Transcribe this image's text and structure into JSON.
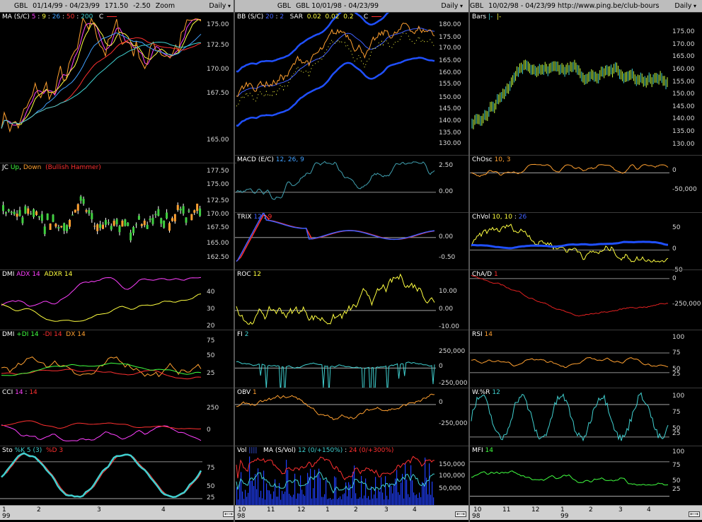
{
  "columns": [
    {
      "header": {
        "symbol": "GBL",
        "range": "01/14/99 - 04/23/99",
        "last": "171.50",
        "change": "-2.50",
        "zoom": "Zoom",
        "period": "Daily"
      },
      "xaxis": {
        "months": [
          "1",
          "2",
          "3",
          "4"
        ],
        "year": "99"
      },
      "panels": [
        {
          "title": [
            {
              "t": "MA (S/C) ",
              "c": "#ffffff"
            },
            {
              "t": "5",
              "c": "#ff40ff"
            },
            {
              "t": " : ",
              "c": "#ffffff"
            },
            {
              "t": "9",
              "c": "#ffff40"
            },
            {
              "t": " : ",
              "c": "#ffffff"
            },
            {
              "t": "26",
              "c": "#40a0ff"
            },
            {
              "t": " : ",
              "c": "#ffffff"
            },
            {
              "t": "50",
              "c": "#ff3030"
            },
            {
              "t": " : ",
              "c": "#ffffff"
            },
            {
              "t": "200",
              "c": "#40d0d0"
            },
            {
              "t": "   C ",
              "c": "#ffffff"
            }
          ],
          "scale": [
            "175.00",
            "172.50",
            "170.00",
            "167.50",
            "165.00"
          ]
        },
        {
          "title": [
            {
              "t": "JC ",
              "c": "#ffffff"
            },
            {
              "t": "Up",
              "c": "#40ff40"
            },
            {
              "t": ", ",
              "c": "#ffffff"
            },
            {
              "t": "Down",
              "c": "#ffa030"
            },
            {
              "t": "  (Bullish Hammer)",
              "c": "#ff3030"
            }
          ],
          "scale": [
            "177.50",
            "175.00",
            "172.50",
            "170.00",
            "167.50",
            "165.00",
            "162.50"
          ]
        },
        {
          "title": [
            {
              "t": "DMI ",
              "c": "#ffffff"
            },
            {
              "t": "ADX 14",
              "c": "#ff40ff"
            },
            {
              "t": "  ",
              "c": "#ffffff"
            },
            {
              "t": "ADXR 14",
              "c": "#ffff40"
            }
          ],
          "scale": [
            "40",
            "30",
            "20"
          ]
        },
        {
          "title": [
            {
              "t": "DMI ",
              "c": "#ffffff"
            },
            {
              "t": "+DI 14",
              "c": "#40ff40"
            },
            {
              "t": "  ",
              "c": "#ffffff"
            },
            {
              "t": "-DI 14",
              "c": "#ff3030"
            },
            {
              "t": "  ",
              "c": "#ffffff"
            },
            {
              "t": "DX 14",
              "c": "#ffa030"
            }
          ],
          "scale": [
            "75",
            "50",
            "25"
          ]
        },
        {
          "title": [
            {
              "t": "CCI ",
              "c": "#ffffff"
            },
            {
              "t": "14",
              "c": "#ff40ff"
            },
            {
              "t": " : ",
              "c": "#ffffff"
            },
            {
              "t": "14",
              "c": "#ff3030"
            }
          ],
          "scale": [
            "250",
            "0"
          ]
        },
        {
          "title": [
            {
              "t": "Sto ",
              "c": "#ffffff"
            },
            {
              "t": "%K 5 (3)",
              "c": "#40d0d0"
            },
            {
              "t": "  ",
              "c": "#ffffff"
            },
            {
              "t": "%D 3",
              "c": "#ff3030"
            }
          ],
          "scale": [
            "75",
            "50",
            "25"
          ]
        }
      ]
    },
    {
      "header": {
        "symbol": "GBL",
        "range": "GBL  10/01/98 - 04/23/99",
        "period": "Daily"
      },
      "xaxis": {
        "months": [
          "10",
          "11",
          "12",
          "1",
          "2",
          "3",
          "4"
        ],
        "year": "98"
      },
      "panels": [
        {
          "title": [
            {
              "t": "BB (S/C) ",
              "c": "#ffffff"
            },
            {
              "t": "20",
              "c": "#4060ff"
            },
            {
              "t": " : ",
              "c": "#ffffff"
            },
            {
              "t": "2",
              "c": "#4060ff"
            },
            {
              "t": "   SAR  ",
              "c": "#ffffff"
            },
            {
              "t": "0.02",
              "c": "#ffff40"
            },
            {
              "t": "  ",
              "c": "#ffffff"
            },
            {
              "t": "0.02",
              "c": "#ffff40"
            },
            {
              "t": "  ",
              "c": "#ffffff"
            },
            {
              "t": "0.2",
              "c": "#ffff40"
            },
            {
              "t": "     C ",
              "c": "#ffffff"
            }
          ],
          "scale": [
            "180.00",
            "175.00",
            "170.00",
            "165.00",
            "160.00",
            "155.00",
            "150.00",
            "145.00",
            "140.00",
            "135.00",
            "130.00"
          ]
        },
        {
          "title": [
            {
              "t": "MACD (E/C) ",
              "c": "#ffffff"
            },
            {
              "t": "12, 26, 9",
              "c": "#40a0ff"
            }
          ],
          "scale": [
            "2.50",
            "0.00"
          ]
        },
        {
          "title": [
            {
              "t": "TRIX ",
              "c": "#ffffff"
            },
            {
              "t": "12",
              "c": "#4060ff"
            },
            {
              "t": " : ",
              "c": "#ffffff"
            },
            {
              "t": "9",
              "c": "#ff3030"
            }
          ],
          "scale": [
            "0.00",
            "-0.50"
          ]
        },
        {
          "title": [
            {
              "t": "ROC ",
              "c": "#ffffff"
            },
            {
              "t": "12",
              "c": "#ffff40"
            }
          ],
          "scale": [
            "10.00",
            "0.00",
            "-10.00"
          ]
        },
        {
          "title": [
            {
              "t": "FI ",
              "c": "#ffffff"
            },
            {
              "t": "2",
              "c": "#40d0d0"
            }
          ],
          "scale": [
            "250,000",
            "0",
            "-250,000"
          ]
        },
        {
          "title": [
            {
              "t": "OBV ",
              "c": "#ffffff"
            },
            {
              "t": "1",
              "c": "#ffa030"
            }
          ],
          "scale": [
            "0",
            "-250,000"
          ]
        },
        {
          "title": [
            {
              "t": "Vol ",
              "c": "#ffffff"
            },
            {
              "t": "||||",
              "c": "#4060ff"
            },
            {
              "t": "   MA (S/Vol) ",
              "c": "#ffffff"
            },
            {
              "t": "12 (0/+150%)",
              "c": "#40d0d0"
            },
            {
              "t": " : ",
              "c": "#ffffff"
            },
            {
              "t": "24 (0/+300%)",
              "c": "#ff3030"
            }
          ],
          "scale": [
            "150,000",
            "100,000",
            "50,000"
          ]
        }
      ]
    },
    {
      "header": {
        "symbol": "GBL",
        "range": "10/02/98 - 04/23/99   http://www.ping.be/club-bourse",
        "period": "Daily"
      },
      "xaxis": {
        "months": [
          "10",
          "11",
          "12",
          "1",
          "2",
          "3",
          "4"
        ],
        "year": "98",
        "year2": "99"
      },
      "panels": [
        {
          "title": [
            {
              "t": "Bars ",
              "c": "#ffffff"
            },
            {
              "t": "|-",
              "c": "#40d0d0"
            },
            {
              "t": "  ",
              "c": "#ffffff"
            },
            {
              "t": "|-",
              "c": "#ffff40"
            }
          ],
          "scale": [
            "175.00",
            "170.00",
            "165.00",
            "160.00",
            "155.00",
            "150.00",
            "145.00",
            "140.00",
            "135.00",
            "130.00"
          ]
        },
        {
          "title": [
            {
              "t": "ChOsc ",
              "c": "#ffffff"
            },
            {
              "t": "10, 3",
              "c": "#ffa030"
            }
          ],
          "scale": [
            "0",
            "-50,000"
          ]
        },
        {
          "title": [
            {
              "t": "ChVol ",
              "c": "#ffffff"
            },
            {
              "t": "10, 10",
              "c": "#ffff40"
            },
            {
              "t": " : ",
              "c": "#ffffff"
            },
            {
              "t": "26",
              "c": "#4060ff"
            }
          ],
          "scale": [
            "50",
            "0",
            "-50"
          ]
        },
        {
          "title": [
            {
              "t": "ChA/D ",
              "c": "#ffffff"
            },
            {
              "t": "1",
              "c": "#ff3030"
            }
          ],
          "scale": [
            "0",
            "-250,000"
          ]
        },
        {
          "title": [
            {
              "t": "RSI ",
              "c": "#ffffff"
            },
            {
              "t": "14",
              "c": "#ffa030"
            }
          ],
          "scale": [
            "100",
            "75",
            "50",
            "25"
          ]
        },
        {
          "title": [
            {
              "t": "W.%R ",
              "c": "#ffffff"
            },
            {
              "t": "12",
              "c": "#40d0d0"
            }
          ],
          "scale": [
            "100",
            "75",
            "50",
            "25"
          ]
        },
        {
          "title": [
            {
              "t": "MFI ",
              "c": "#ffffff"
            },
            {
              "t": "14",
              "c": "#40ff40"
            }
          ],
          "scale": [
            "100",
            "75",
            "50",
            "25"
          ]
        }
      ]
    }
  ]
}
